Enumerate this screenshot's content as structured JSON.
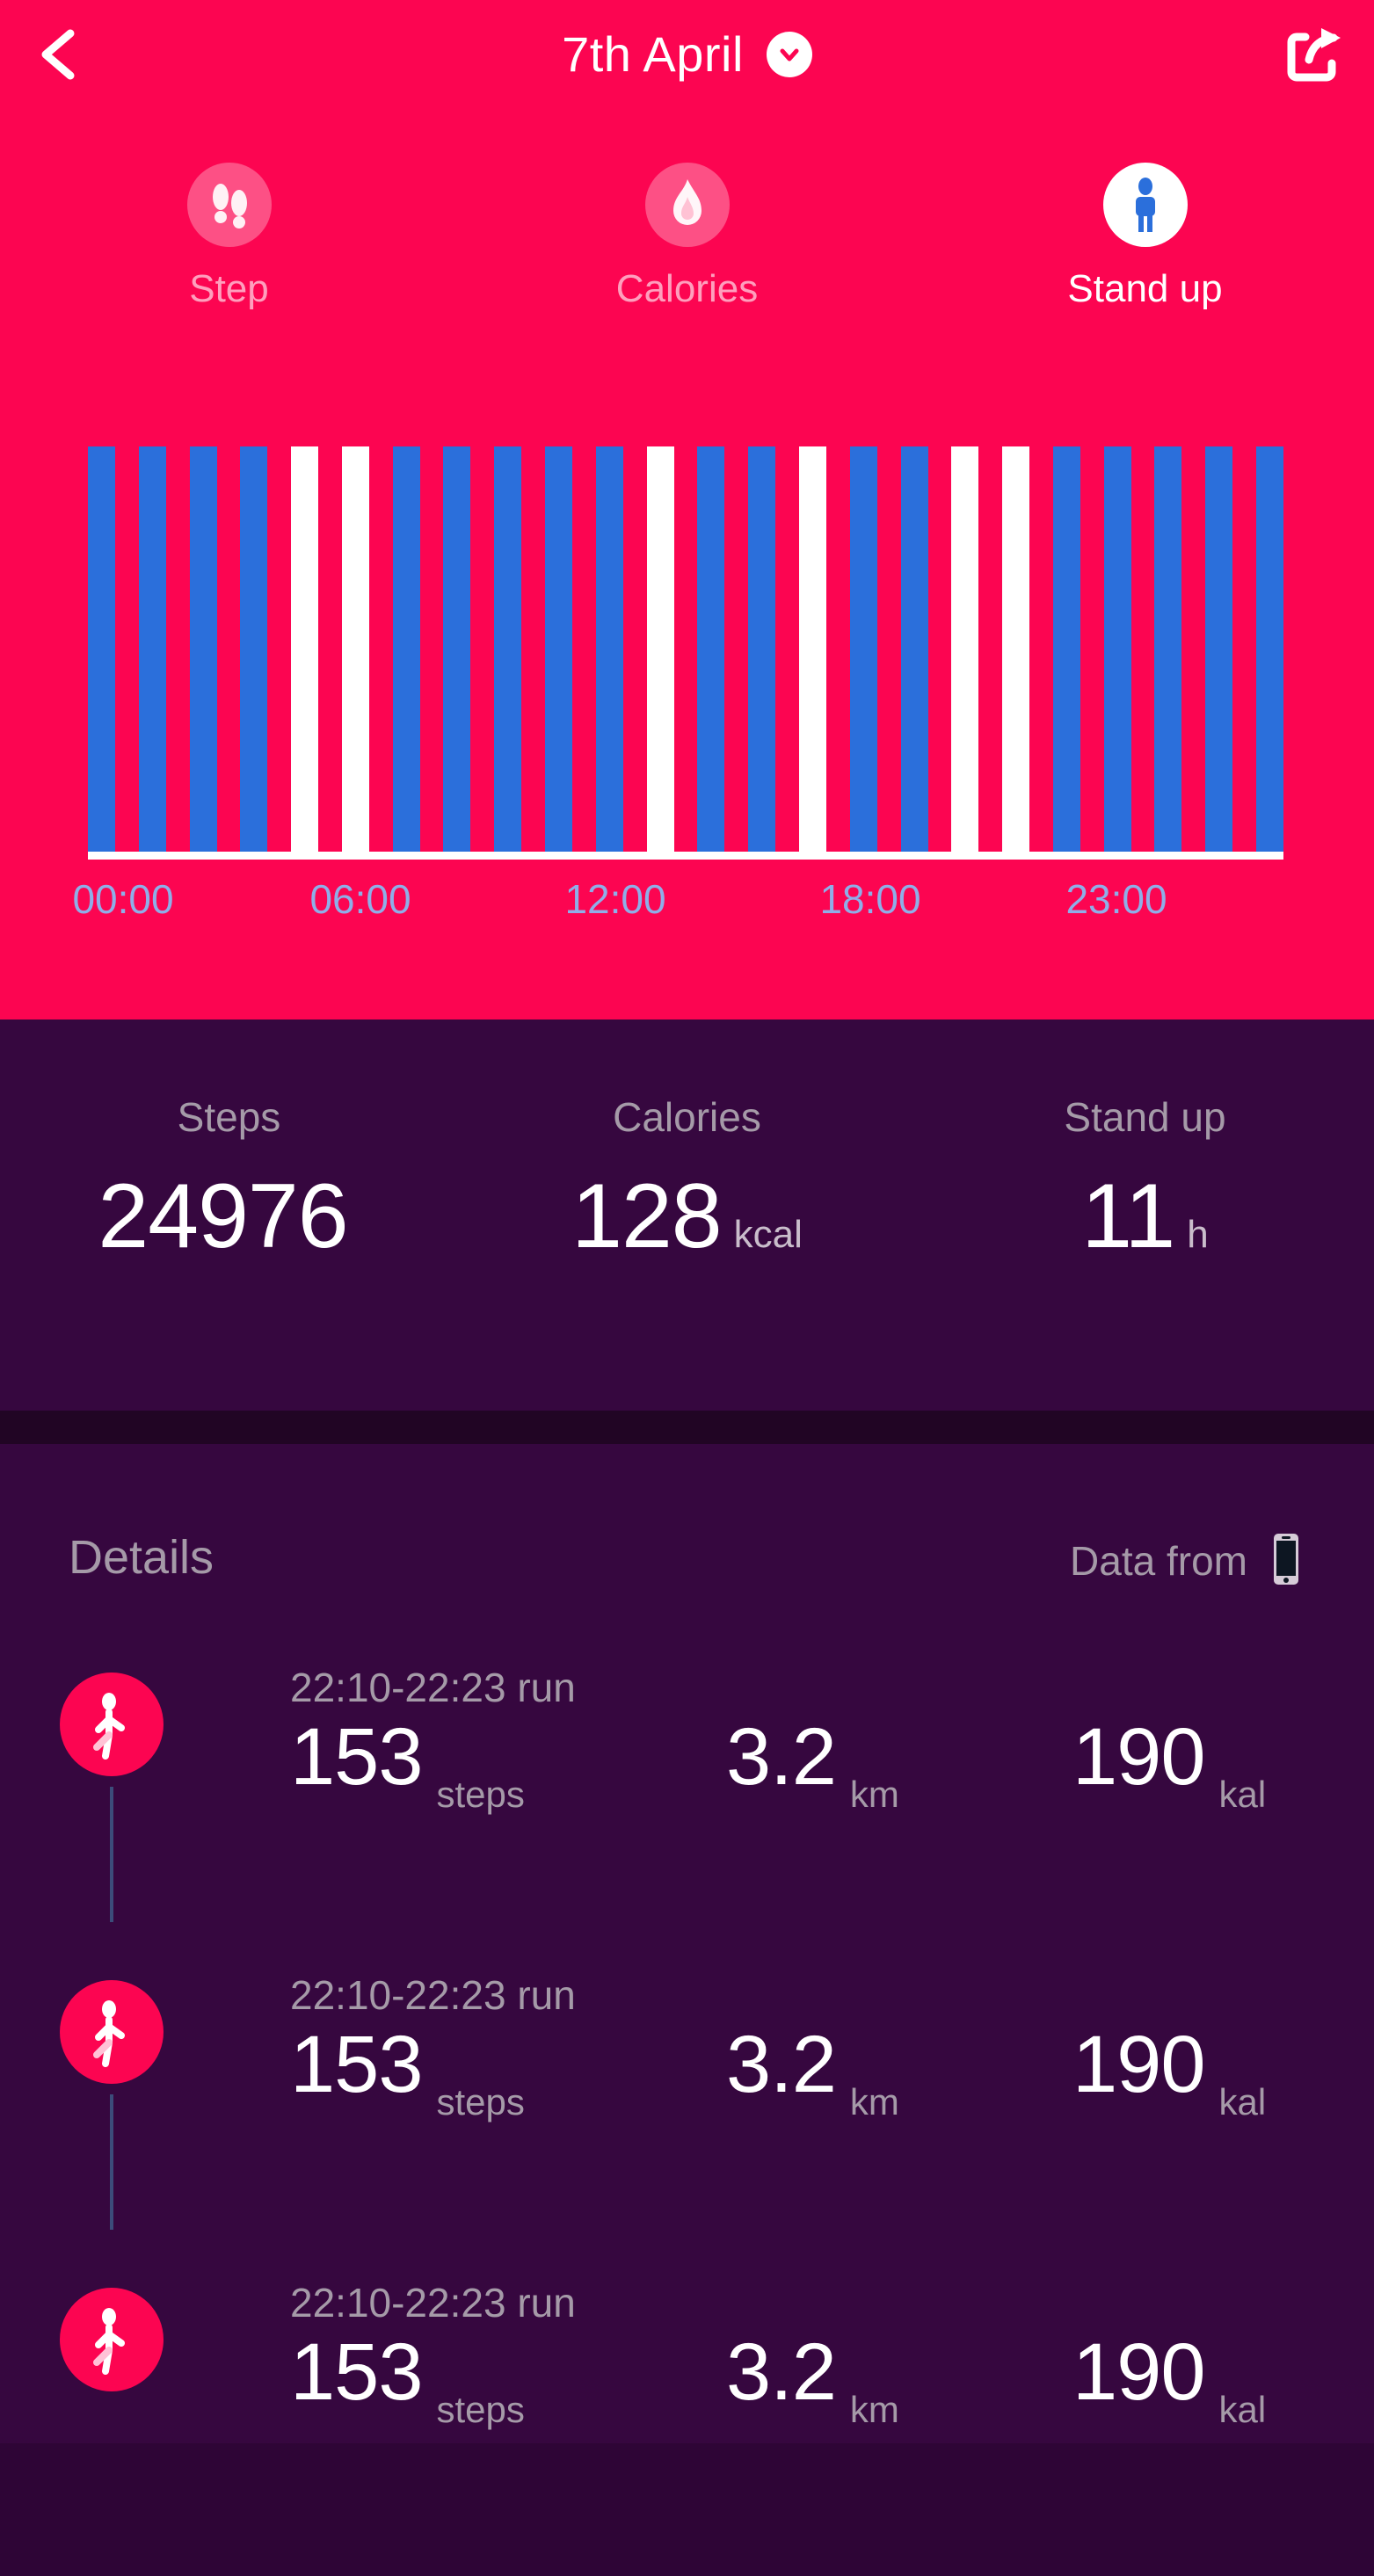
{
  "theme": {
    "accent_pink": "#FC0551",
    "bar_blue": "#2B6FDB",
    "bar_white": "#FFFFFF",
    "panel_dark": "#36073F",
    "divider_dark": "#210524",
    "muted_text": "#A59AA8",
    "axis_label_blue": "#8FAEE8"
  },
  "navbar": {
    "back_icon": "chevron-left-icon",
    "title": "7th April",
    "dropdown_icon": "chevron-down-icon",
    "share_icon": "share-icon"
  },
  "tabs": [
    {
      "label": "Step",
      "icon": "footprints-icon",
      "active": false
    },
    {
      "label": "Calories",
      "icon": "flame-icon",
      "active": false
    },
    {
      "label": "Stand up",
      "icon": "person-standing-icon",
      "active": true
    }
  ],
  "chart_data": {
    "type": "bar",
    "title": "Stand up",
    "xlabel": "",
    "ylabel": "",
    "grid": false,
    "legend": null,
    "axis_tick_labels": [
      "00:00",
      "06:00",
      "12:00",
      "18:00",
      "23:00"
    ],
    "categories": [
      "00",
      "01",
      "02",
      "03",
      "04",
      "05",
      "06",
      "07",
      "08",
      "09",
      "10",
      "11",
      "12",
      "13",
      "14",
      "15",
      "16",
      "17",
      "18",
      "19",
      "20",
      "21",
      "22",
      "23"
    ],
    "values": [
      1,
      1,
      1,
      1,
      1,
      1,
      1,
      1,
      1,
      1,
      1,
      1,
      1,
      1,
      1,
      1,
      1,
      1,
      1,
      1,
      1,
      1,
      1,
      1
    ],
    "bar_colors": [
      "blue",
      "blue",
      "blue",
      "blue",
      "white",
      "white",
      "blue",
      "blue",
      "blue",
      "blue",
      "blue",
      "white",
      "blue",
      "blue",
      "white",
      "blue",
      "blue",
      "white",
      "white",
      "blue",
      "blue",
      "blue",
      "blue",
      "blue"
    ],
    "ylim": [
      0,
      1
    ]
  },
  "stats": [
    {
      "label": "Steps",
      "value": "24976",
      "unit": ""
    },
    {
      "label": "Calories",
      "value": "128",
      "unit": "kcal"
    },
    {
      "label": "Stand up",
      "value": "11",
      "unit": "h"
    }
  ],
  "details": {
    "title": "Details",
    "data_from_label": "Data from",
    "data_from_icon": "phone-icon",
    "activities": [
      {
        "time": "22:10-22:23  run",
        "icon": "running-person-icon",
        "steps": "153",
        "steps_unit": "steps",
        "distance": "3.2",
        "distance_unit": "km",
        "calories": "190",
        "calories_unit": "kal"
      },
      {
        "time": "22:10-22:23  run",
        "icon": "running-person-icon",
        "steps": "153",
        "steps_unit": "steps",
        "distance": "3.2",
        "distance_unit": "km",
        "calories": "190",
        "calories_unit": "kal"
      },
      {
        "time": "22:10-22:23  run",
        "icon": "running-person-icon",
        "steps": "153",
        "steps_unit": "steps",
        "distance": "3.2",
        "distance_unit": "km",
        "calories": "190",
        "calories_unit": "kal"
      }
    ]
  }
}
